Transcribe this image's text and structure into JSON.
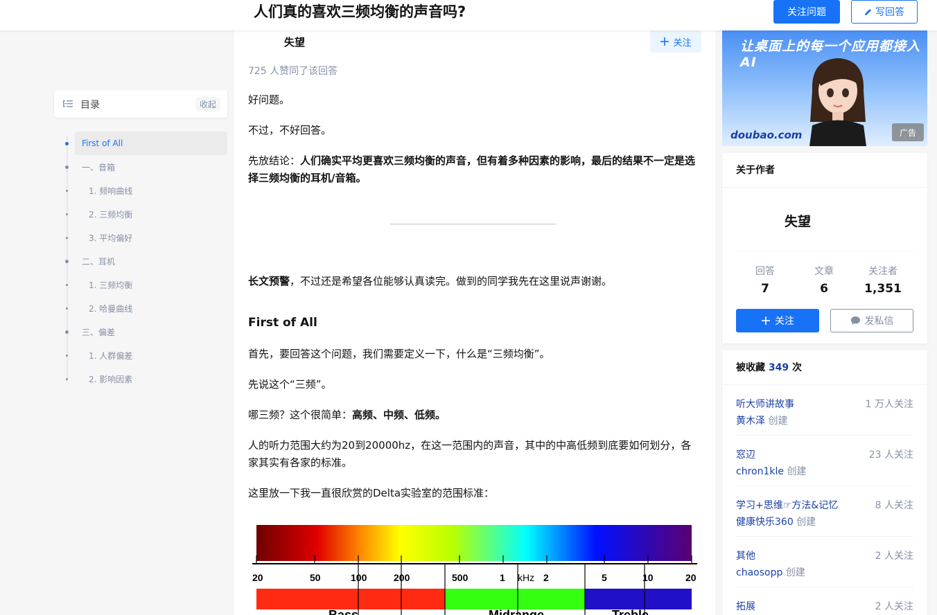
{
  "header": {
    "question_title": "人们真的喜欢三频均衡的声音吗?",
    "follow_question_label": "关注问题",
    "write_answer_label": "写回答"
  },
  "toc": {
    "title": "目录",
    "collapse_label": "收起",
    "items": [
      {
        "label": "First of All",
        "level": 1,
        "active": true
      },
      {
        "label": "一、音箱",
        "level": 1
      },
      {
        "label": "1. 频响曲线",
        "level": 2
      },
      {
        "label": "2. 三频均衡",
        "level": 2
      },
      {
        "label": "3. 平均偏好",
        "level": 2
      },
      {
        "label": "二、耳机",
        "level": 1
      },
      {
        "label": "1. 三频均衡",
        "level": 2
      },
      {
        "label": "2. 哈曼曲线",
        "level": 2
      },
      {
        "label": "三、偏差",
        "level": 1
      },
      {
        "label": "1. 人群偏差",
        "level": 2
      },
      {
        "label": "2. 影响因素",
        "level": 2
      }
    ]
  },
  "answer": {
    "author_name": "失望",
    "follow_label": "关注",
    "votes_text": "725 人赞同了该回答",
    "p1": "好问题。",
    "p2": "不过，不好回答。",
    "p3_prefix": "先放结论：",
    "p3_bold": "人们确实平均更喜欢三频均衡的声音，但有着多种因素的影响，最后的结果不一定是选择三频均衡的耳机/音箱。",
    "p4_bold": "长文预警",
    "p4_rest": "，不过还是希望各位能够认真读完。做到的同学我先在这里说声谢谢。",
    "h_first": "First of All",
    "p5": "首先，要回答这个问题，我们需要定义一下，什么是“三频均衡”。",
    "p6": "先说这个“三频”。",
    "p7_prefix": "哪三频？这个很简单：",
    "p7_bold": "高频、中频、低频。",
    "p8": "人的听力范围大约为20到20000hz，在这一范围内的声音，其中的中高低频到底要如何划分，各家其实有各家的标准。",
    "p9": "这里放一下我一直很欣赏的Delta实验室的范围标准：",
    "figure": {
      "tick_labels": [
        "20",
        "50",
        "100",
        "200",
        "500",
        "1",
        "kHz",
        "2",
        "5",
        "10",
        "20"
      ],
      "band_labels": [
        "Bass",
        "Midrange",
        "Treble"
      ]
    }
  },
  "ad": {
    "slogan": "让桌面上的每一个应用都接入AI",
    "domain": "doubao.com",
    "tag": "广告"
  },
  "author_card": {
    "title": "关于作者",
    "name": "失望",
    "stats": [
      {
        "label": "回答",
        "value": "7"
      },
      {
        "label": "文章",
        "value": "6"
      },
      {
        "label": "关注者",
        "value": "1,351"
      }
    ],
    "follow_label": "关注",
    "message_label": "发私信"
  },
  "favorites": {
    "title_prefix": "被收藏",
    "count": "349",
    "title_suffix": "次",
    "items": [
      {
        "name": "听大师讲故事",
        "followers": "1 万人关注",
        "creator": "黄木泽",
        "created": "创建"
      },
      {
        "name": "窓辺",
        "followers": "23 人关注",
        "creator": "chron1kle",
        "created": "创建"
      },
      {
        "name": "学习+思维☞方法&记忆",
        "followers": "8 人关注",
        "creator": "健康快乐360",
        "created": "创建"
      },
      {
        "name": "其他",
        "followers": "2 人关注",
        "creator": "chaosopp",
        "created": "创建"
      },
      {
        "name": "拓展",
        "followers": "2 人关注",
        "creator": "",
        "created": ""
      }
    ]
  },
  "colors": {
    "accent": "#1772f6",
    "link": "#1a3fa8",
    "muted": "#8590a6"
  }
}
